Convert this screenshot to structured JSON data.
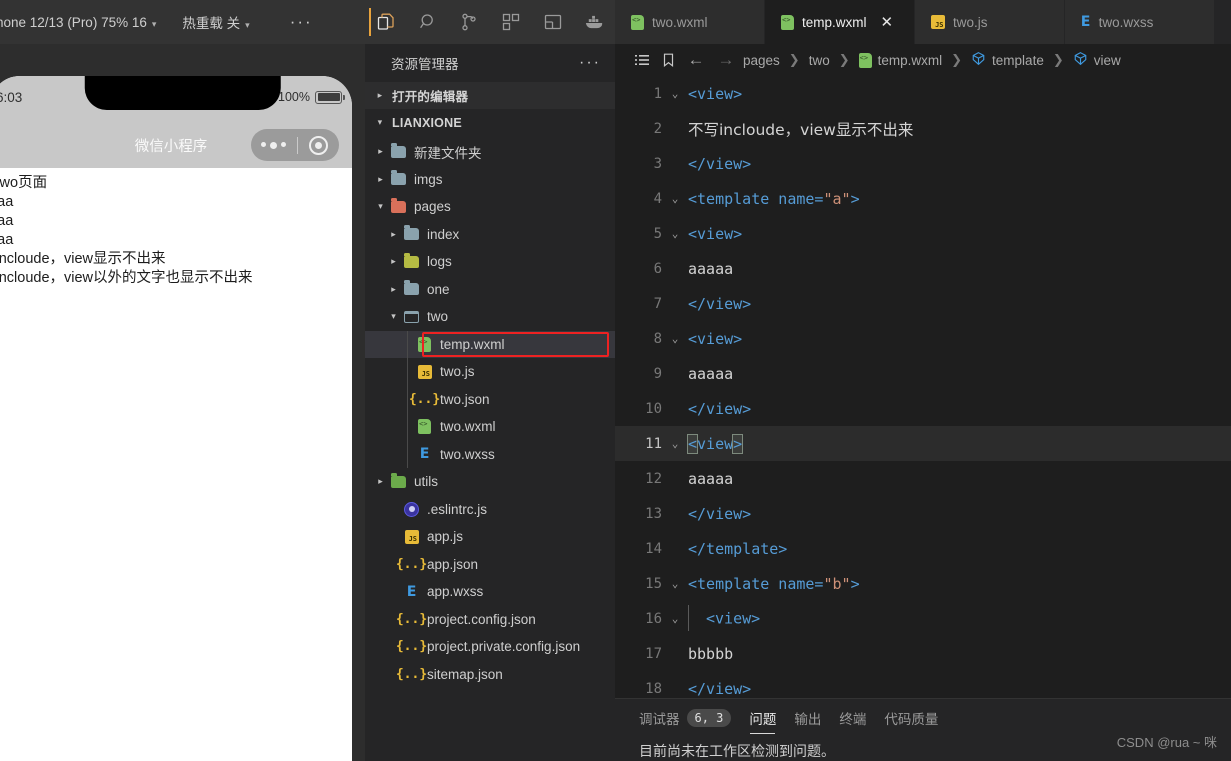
{
  "simulator": {
    "toolbar": {
      "device": "hone 12/13 (Pro) 75% 16",
      "device_caret": "▾",
      "hot_reload": "热重载 关",
      "hot_caret": "▾",
      "more": "···"
    },
    "status_bar": {
      "time": "6:03",
      "battery_pct": "100%"
    },
    "nav_bar": {
      "title": "微信小程序"
    },
    "page_lines": [
      "是two页面",
      "aaaa",
      "aaaa",
      "aaaa",
      "写incloude，view显示不出来",
      "写incloude，view以外的文字也显示不出来"
    ]
  },
  "activity_bar": {
    "items": [
      {
        "name": "explorer",
        "icon": "files-icon",
        "active": true
      },
      {
        "name": "search",
        "icon": "search-icon",
        "active": false
      },
      {
        "name": "source-control",
        "icon": "source-control-icon",
        "active": false
      },
      {
        "name": "extensions",
        "icon": "extensions-icon",
        "active": false
      },
      {
        "name": "layout",
        "icon": "layout-panel-icon",
        "active": false
      },
      {
        "name": "docker",
        "icon": "docker-whale-icon",
        "active": false
      }
    ]
  },
  "sidebar": {
    "title": "资源管理器",
    "more": "···",
    "sections": [
      {
        "label": "打开的编辑器",
        "expanded": false,
        "twisty": "▸"
      },
      {
        "label": "LIANXIONE",
        "expanded": true,
        "twisty": "▾"
      }
    ],
    "tree": [
      {
        "label": "新建文件夹",
        "kind": "folder",
        "icon": "folder-icon",
        "twisty": "▸",
        "indent": 2
      },
      {
        "label": "imgs",
        "kind": "folder",
        "icon": "folder-icon",
        "twisty": "▸",
        "indent": 2
      },
      {
        "label": "pages",
        "kind": "folder-pages",
        "icon": "folder-open-pages-icon",
        "twisty": "▾",
        "indent": 2
      },
      {
        "label": "index",
        "kind": "folder",
        "icon": "folder-icon",
        "twisty": "▸",
        "indent": 3
      },
      {
        "label": "logs",
        "kind": "folder-logs",
        "icon": "folder-logs-icon",
        "twisty": "▸",
        "indent": 3
      },
      {
        "label": "one",
        "kind": "folder",
        "icon": "folder-icon",
        "twisty": "▸",
        "indent": 3
      },
      {
        "label": "two",
        "kind": "folder-open",
        "icon": "folder-open-icon",
        "twisty": "▾",
        "indent": 3
      },
      {
        "label": "temp.wxml",
        "kind": "wxml",
        "icon": "wxml-file-icon",
        "twisty": "",
        "indent": 4,
        "selected": true,
        "highlighted": true
      },
      {
        "label": "two.js",
        "kind": "js",
        "icon": "js-file-icon",
        "twisty": "",
        "indent": 4
      },
      {
        "label": "two.json",
        "kind": "json",
        "icon": "json-file-icon",
        "twisty": "",
        "indent": 4
      },
      {
        "label": "two.wxml",
        "kind": "wxml",
        "icon": "wxml-file-icon",
        "twisty": "",
        "indent": 4
      },
      {
        "label": "two.wxss",
        "kind": "wxss",
        "icon": "wxss-file-icon",
        "twisty": "",
        "indent": 4
      },
      {
        "label": "utils",
        "kind": "folder-utils",
        "icon": "folder-utils-icon",
        "twisty": "▸",
        "indent": 2
      },
      {
        "label": ".eslintrc.js",
        "kind": "eslint",
        "icon": "eslint-file-icon",
        "twisty": "",
        "indent": 3
      },
      {
        "label": "app.js",
        "kind": "js",
        "icon": "js-file-icon",
        "twisty": "",
        "indent": 3
      },
      {
        "label": "app.json",
        "kind": "json",
        "icon": "json-file-icon",
        "twisty": "",
        "indent": 3
      },
      {
        "label": "app.wxss",
        "kind": "wxss",
        "icon": "wxss-file-icon",
        "twisty": "",
        "indent": 3
      },
      {
        "label": "project.config.json",
        "kind": "json",
        "icon": "json-file-icon",
        "twisty": "",
        "indent": 3
      },
      {
        "label": "project.private.config.json",
        "kind": "json",
        "icon": "json-file-icon",
        "twisty": "",
        "indent": 3
      },
      {
        "label": "sitemap.json",
        "kind": "json",
        "icon": "json-file-icon",
        "twisty": "",
        "indent": 3
      }
    ]
  },
  "editor": {
    "tabs": [
      {
        "label": "two.wxml",
        "icon": "wxml-file-icon",
        "active": false,
        "closable": false
      },
      {
        "label": "temp.wxml",
        "icon": "wxml-file-icon",
        "active": true,
        "closable": true,
        "close": "✕"
      },
      {
        "label": "two.js",
        "icon": "js-file-icon",
        "active": false,
        "closable": false
      },
      {
        "label": "two.wxss",
        "icon": "wxss-file-icon",
        "active": false,
        "closable": false
      }
    ],
    "breadcrumb": {
      "outline_icon": "list-icon",
      "bookmark_icon": "bookmark-icon",
      "back": "←",
      "forward": "→",
      "sep": "❯",
      "items": [
        {
          "label": "pages",
          "icon": ""
        },
        {
          "label": "two",
          "icon": ""
        },
        {
          "label": "temp.wxml",
          "icon": "wxml-file-icon"
        },
        {
          "label": "template",
          "icon": "symbol-cube-icon"
        },
        {
          "label": "view",
          "icon": "symbol-cube-icon"
        }
      ]
    },
    "lines": [
      {
        "n": "1",
        "fold": "⌄",
        "segments": [
          {
            "t": "<view>",
            "c": "tag"
          }
        ]
      },
      {
        "n": "2",
        "fold": "",
        "segments": [
          {
            "t": "不写incloude，view显示不出来",
            "c": "cn"
          }
        ]
      },
      {
        "n": "3",
        "fold": "",
        "segments": [
          {
            "t": "</view>",
            "c": "tag"
          }
        ]
      },
      {
        "n": "4",
        "fold": "⌄",
        "segments": [
          {
            "t": "<template name=",
            "c": "tag"
          },
          {
            "t": "\"a\"",
            "c": "str"
          },
          {
            "t": ">",
            "c": "tag"
          }
        ]
      },
      {
        "n": "5",
        "fold": "⌄",
        "segments": [
          {
            "t": "<view>",
            "c": "tag"
          }
        ]
      },
      {
        "n": "6",
        "fold": "",
        "segments": [
          {
            "t": "aaaaa",
            "c": "plain"
          }
        ]
      },
      {
        "n": "7",
        "fold": "",
        "segments": [
          {
            "t": "</view>",
            "c": "tag"
          }
        ]
      },
      {
        "n": "8",
        "fold": "⌄",
        "segments": [
          {
            "t": "<view>",
            "c": "tag"
          }
        ]
      },
      {
        "n": "9",
        "fold": "",
        "segments": [
          {
            "t": "aaaaa",
            "c": "plain"
          }
        ]
      },
      {
        "n": "10",
        "fold": "",
        "segments": [
          {
            "t": "</view>",
            "c": "tag"
          }
        ]
      },
      {
        "n": "11",
        "fold": "⌄",
        "active": true,
        "segments": [
          {
            "t": "<",
            "c": "tag brk"
          },
          {
            "t": "view",
            "c": "tag"
          },
          {
            "t": ">",
            "c": "tag brk"
          }
        ]
      },
      {
        "n": "12",
        "fold": "",
        "segments": [
          {
            "t": "aaaaa",
            "c": "plain"
          }
        ]
      },
      {
        "n": "13",
        "fold": "",
        "segments": [
          {
            "t": "</view>",
            "c": "tag"
          }
        ]
      },
      {
        "n": "14",
        "fold": "",
        "segments": [
          {
            "t": "</template>",
            "c": "tag"
          }
        ]
      },
      {
        "n": "15",
        "fold": "⌄",
        "segments": [
          {
            "t": "<template name=",
            "c": "tag"
          },
          {
            "t": "\"b\"",
            "c": "str"
          },
          {
            "t": ">",
            "c": "tag"
          }
        ]
      },
      {
        "n": "16",
        "fold": "⌄",
        "indented": true,
        "segments": [
          {
            "t": "<view>",
            "c": "tag"
          }
        ]
      },
      {
        "n": "17",
        "fold": "",
        "segments": [
          {
            "t": "bbbbb",
            "c": "plain"
          }
        ]
      },
      {
        "n": "18",
        "fold": "",
        "segments": [
          {
            "t": "</view>",
            "c": "tag"
          }
        ]
      }
    ]
  },
  "panel": {
    "tabs": [
      {
        "label": "调试器",
        "badge": "6, 3",
        "active": false
      },
      {
        "label": "问题",
        "badge": "",
        "active": true
      },
      {
        "label": "输出",
        "badge": "",
        "active": false
      },
      {
        "label": "终端",
        "badge": "",
        "active": false
      },
      {
        "label": "代码质量",
        "badge": "",
        "active": false
      }
    ],
    "message": "目前尚未在工作区检测到问题。",
    "watermark": "CSDN @rua ~ 咪"
  }
}
